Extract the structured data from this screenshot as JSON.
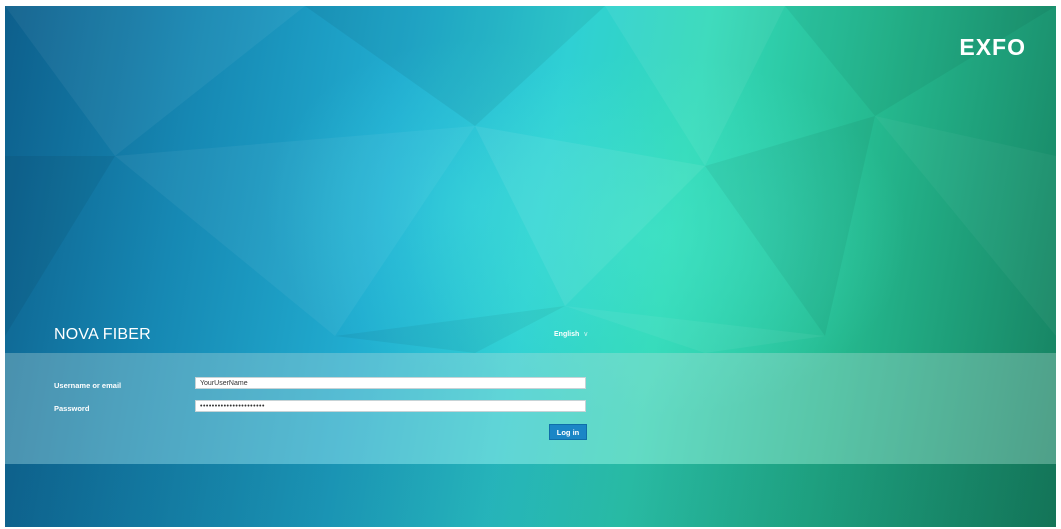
{
  "brand": {
    "logo_text": "EXFO",
    "product_name": "NOVA FIBER"
  },
  "language": {
    "selected": "English",
    "chevron": "∨"
  },
  "login_form": {
    "username_label": "Username or email",
    "username_value": "YourUserName",
    "password_label": "Password",
    "password_value": "••••••••••••••••••••••",
    "submit_label": "Log in"
  },
  "colors": {
    "accent_button": "#1b86c6",
    "background_left": "#0d5f8c",
    "background_center": "#2fd0d4",
    "background_right": "#167f5f"
  }
}
